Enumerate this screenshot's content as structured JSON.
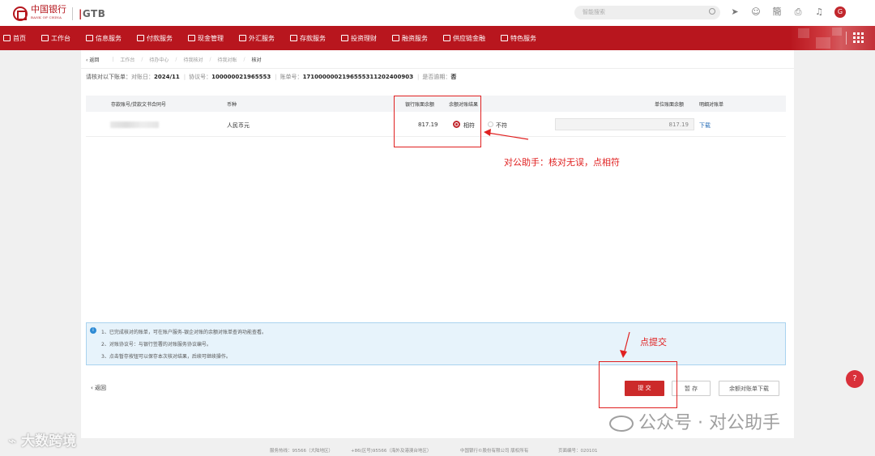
{
  "logo": {
    "cn": "中国银行",
    "en": "BANK OF CHINA",
    "gtb": "GTB"
  },
  "search": {
    "placeholder": "智能搜索"
  },
  "nav": [
    {
      "label": "首页"
    },
    {
      "label": "工作台"
    },
    {
      "label": "信息服务"
    },
    {
      "label": "付款服务"
    },
    {
      "label": "现金管理"
    },
    {
      "label": "外汇服务"
    },
    {
      "label": "存款服务"
    },
    {
      "label": "投资理财"
    },
    {
      "label": "融资服务"
    },
    {
      "label": "供应链金融"
    },
    {
      "label": "特色服务"
    }
  ],
  "breadcrumb": {
    "back": "返回",
    "items": [
      "工作台",
      "待办中心",
      "待我核对",
      "待我对账"
    ],
    "current": "核对"
  },
  "info": {
    "prompt": "请核对以下账单：",
    "period_label": "对账日：",
    "period": "2024/11",
    "agreement_label": "协议号：",
    "agreement": "100000021965553",
    "bill_label": "账单号：",
    "bill": "171000000219655531120240090З",
    "overdue_label": "是否逾期：",
    "overdue": "否"
  },
  "table": {
    "headers": [
      "存款账号/贷款文书合同号",
      "币种",
      "银行账面余额",
      "余额对账结果",
      "单位账面余额",
      "明细对账单"
    ],
    "row": {
      "currency": "人民币元",
      "bank_balance": "817.19",
      "match": "相符",
      "nomatch": "不符",
      "unit_balance": "817.19",
      "download": "下载"
    }
  },
  "annotations": {
    "a1": "对公助手：核对无误，点相符",
    "a2": "点提交"
  },
  "notice": [
    "1、已完成核对的账单，可在账户服务-银企对账的余额对账单查询功能查看。",
    "2、对账协议号：与银行签署的对账服务协议编号。",
    "3、点击暂存按钮可以保存本次核对结果，后续可继续操作。"
  ],
  "actions": {
    "back": "返回",
    "submit": "提 交",
    "save": "暂 存",
    "download": "余额对账单下载"
  },
  "footer": {
    "hotline": "服务热线：95566（大陆地区）",
    "overseas": "+86(区号)95566（海外及港澳台地区）",
    "copyright": "中国银行©股份有限公司 版权所有",
    "page_no": "页面编号：020101"
  },
  "watermarks": {
    "left": "大数跨境",
    "right": "公众号 · 对公助手"
  },
  "colors": {
    "brand": "#b8161e",
    "annotation": "#e02020",
    "link": "#2a6fb8"
  }
}
